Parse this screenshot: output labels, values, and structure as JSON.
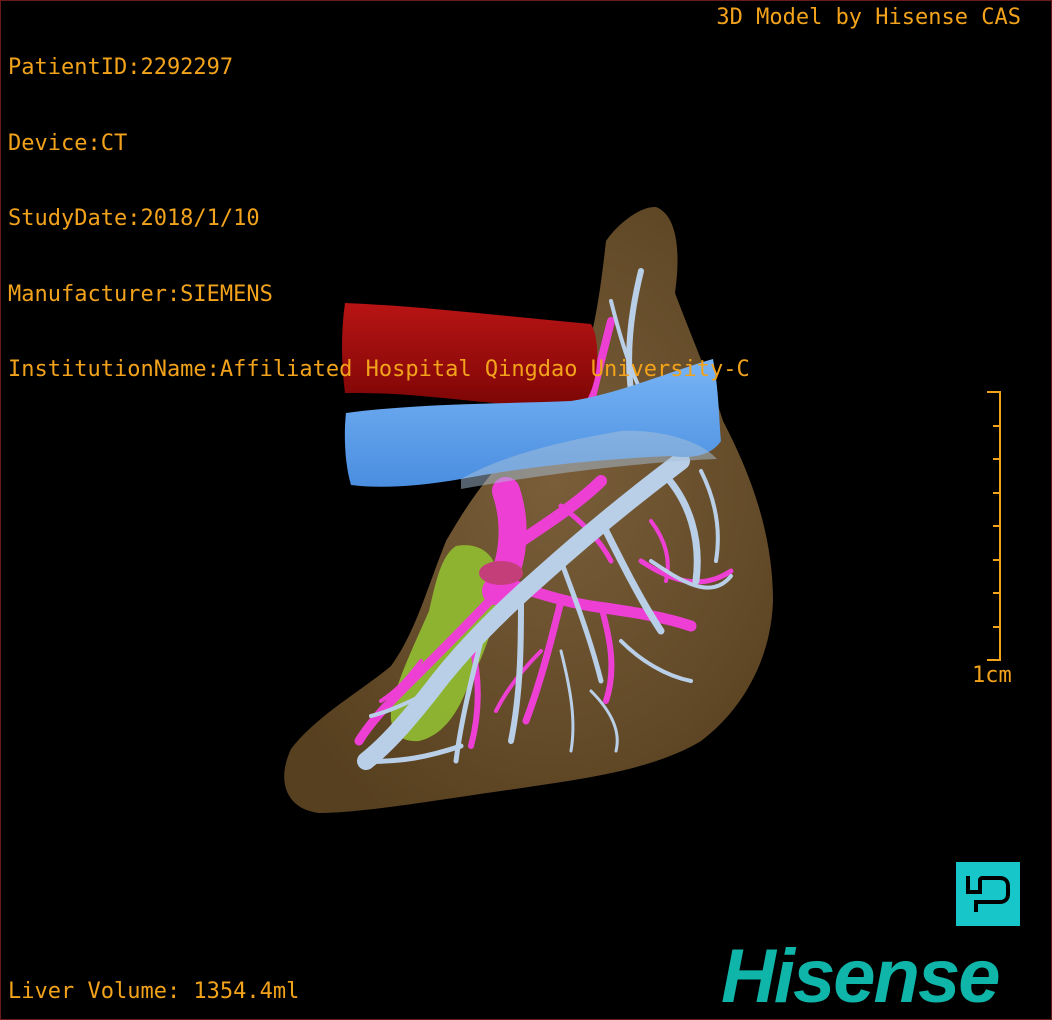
{
  "patient_info": {
    "patient_id": "PatientID:2292297",
    "device": "Device:CT",
    "study_date": "StudyDate:2018/1/10",
    "manufacturer": "Manufacturer:SIEMENS",
    "institution": "InstitutionName:Affiliated Hospital Qingdao University-C"
  },
  "brand_label": "3D Model by Hisense CAS",
  "liver_volume": "Liver Volume: 1354.4ml",
  "scale_bar": {
    "label": "1cm",
    "tick_count": 9
  },
  "logos": {
    "p_logo_icon": "p-logo-icon",
    "hisense_wordmark": "Hisense"
  },
  "colors": {
    "overlay_text": "#f2a31b",
    "liver": "#6e5434",
    "artery": "#a30a0a",
    "vein": "#5aa0ee",
    "portal_vein": "#ee3fd5",
    "hepatic_veins": "#b9cfe8",
    "tumor": "#8fb832",
    "logo_teal": "#16c6c9"
  }
}
